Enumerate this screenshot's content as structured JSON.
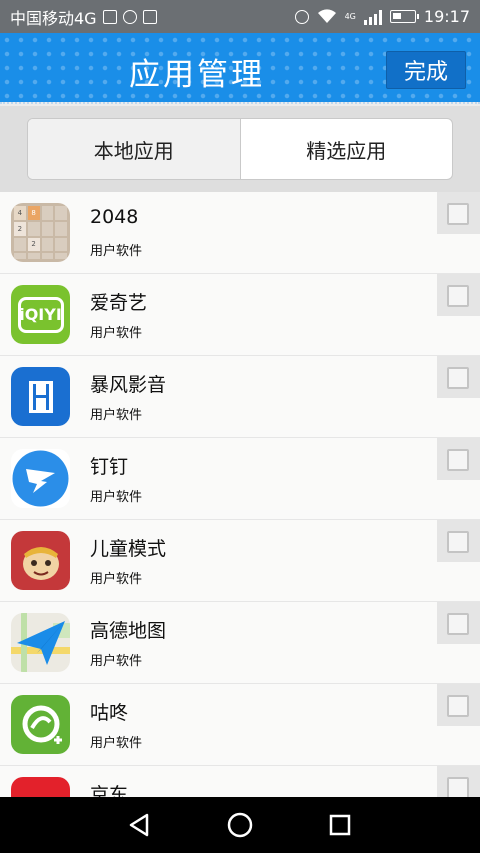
{
  "status_bar": {
    "carrier": "中国移动4G",
    "network": "4G",
    "time": "19:17",
    "icons": [
      "image-icon",
      "sync-icon",
      "sim-icon",
      "alarm-icon",
      "wifi-icon",
      "signal-icon",
      "battery-icon"
    ]
  },
  "header": {
    "title": "应用管理",
    "done_label": "完成",
    "colors": {
      "bar": "#1a8ee8",
      "button": "#1170c8"
    }
  },
  "tabs": [
    {
      "label": "本地应用",
      "active": true
    },
    {
      "label": "精选应用",
      "active": false
    }
  ],
  "apps": [
    {
      "name": "2048",
      "type": "用户软件",
      "icon": "game-2048-icon",
      "checked": false
    },
    {
      "name": "爱奇艺",
      "type": "用户软件",
      "icon": "iqiyi-icon",
      "icon_text": "iQIYI",
      "checked": false
    },
    {
      "name": "暴风影音",
      "type": "用户软件",
      "icon": "film-icon",
      "checked": false
    },
    {
      "name": "钉钉",
      "type": "用户软件",
      "icon": "dingtalk-icon",
      "checked": false
    },
    {
      "name": "儿童模式",
      "type": "用户软件",
      "icon": "monkey-icon",
      "checked": false
    },
    {
      "name": "高德地图",
      "type": "用户软件",
      "icon": "map-plane-icon",
      "checked": false
    },
    {
      "name": "咕咚",
      "type": "用户软件",
      "icon": "runner-icon",
      "checked": false
    },
    {
      "name": "京东",
      "type": "",
      "icon": "jd-icon",
      "checked": false
    }
  ],
  "tile_2048": [
    "4",
    "8",
    "",
    "",
    "2",
    "",
    "",
    "",
    "",
    "2",
    "",
    "",
    "",
    "",
    "",
    ""
  ],
  "nav": {
    "icons": [
      "back-icon",
      "home-icon",
      "recents-icon"
    ]
  }
}
